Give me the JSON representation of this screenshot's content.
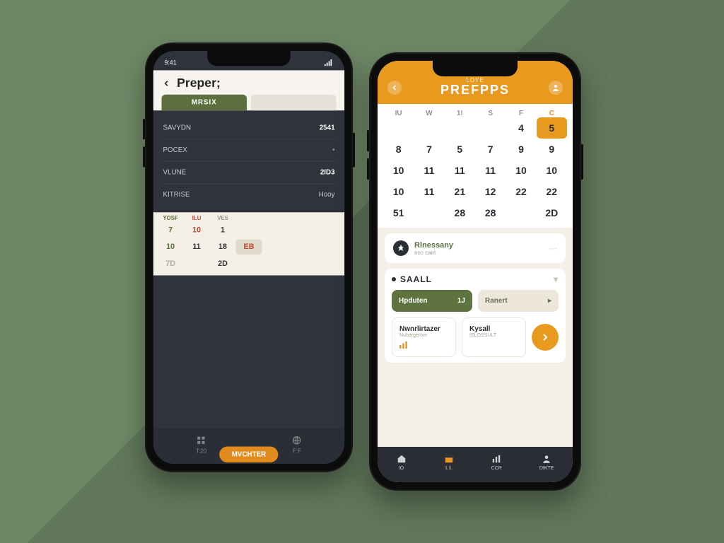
{
  "colors": {
    "accent_orange": "#e89a1f",
    "accent_green": "#5d6f3e",
    "bg_sage": "#6e8866",
    "dark": "#2a2d33"
  },
  "phoneA": {
    "status": {
      "time": "9:41"
    },
    "header": {
      "back_icon": "chevron-left-icon",
      "title": "Preper;",
      "tabs": [
        {
          "label": "MRSIX",
          "active": true
        },
        {
          "label": "",
          "active": false
        }
      ]
    },
    "rows": [
      {
        "label": "SAVYDN",
        "value": "2541"
      },
      {
        "label": "POCEX",
        "value": ""
      },
      {
        "label": "VLUNE",
        "value": "2ID3"
      },
      {
        "label_left": "KITRISE",
        "label_right": "Hooy",
        "split": true
      }
    ],
    "calendar": {
      "header": [
        "YOSF",
        "ILU",
        "VES",
        "",
        "",
        "",
        ""
      ],
      "rows": [
        [
          "7",
          "10",
          "1",
          "",
          "",
          "",
          ""
        ],
        [
          "10",
          "11",
          "18",
          "EB",
          "",
          "",
          ""
        ],
        [
          "7D",
          "",
          "2D",
          "",
          "",
          "",
          ""
        ]
      ]
    },
    "bottom": {
      "items": [
        {
          "icon": "grid-icon",
          "label": "T:20"
        },
        {
          "icon": "globe-icon",
          "label": "F:F"
        }
      ],
      "cta": "MVCHTER"
    }
  },
  "phoneB": {
    "header": {
      "left_icon": "back-icon",
      "subtitle": "LOYE",
      "title": "PREFPPS",
      "right_icon": "profile-icon"
    },
    "calendar": {
      "dow": [
        "IU",
        "W",
        "1!",
        "S",
        "F",
        "C"
      ],
      "dow_active_index": 5,
      "weeks": [
        [
          "",
          "",
          "",
          "",
          "4",
          "5"
        ],
        [
          "8",
          "7",
          "5",
          "7",
          "9",
          "9"
        ],
        [
          "10",
          "11",
          "11",
          "11",
          "10",
          "10"
        ],
        [
          "10",
          "11",
          "21",
          "12",
          "22",
          "22"
        ],
        [
          "51",
          "",
          "28",
          "28",
          "",
          "2D"
        ]
      ],
      "selected": {
        "row": 0,
        "col": 5
      },
      "orange_cells": [
        [
          1,
          0
        ]
      ],
      "green_cells": [
        [
          4,
          0
        ]
      ],
      "faded_cells": [
        [
          0,
          0
        ],
        [
          0,
          1
        ],
        [
          0,
          2
        ],
        [
          0,
          3
        ],
        [
          4,
          1
        ],
        [
          4,
          4
        ]
      ]
    },
    "event": {
      "icon": "pin-icon",
      "label": "Rlnessany",
      "sub": "noɔ caet",
      "trail_icon": "dots-icon"
    },
    "section": {
      "title": "SAALL",
      "toggle_icon": "chevron-down-icon",
      "cards": [
        {
          "style": "green",
          "label": "Hpduten",
          "value": "1J"
        },
        {
          "style": "tan",
          "label": "Ranert",
          "value": ""
        }
      ],
      "cards2": [
        {
          "title": "Nwnrlirtazer",
          "sub": "Nubergeroer",
          "icon": "bars-icon"
        },
        {
          "title": "Kysall",
          "sub": "ISLOSSULT",
          "icon": "stat-icon"
        }
      ],
      "fab_icon": "arrow-right-icon"
    },
    "bottom": {
      "items": [
        {
          "icon": "home-icon",
          "label": "IO"
        },
        {
          "icon": "cal-icon",
          "label": "ILIL",
          "highlight": true
        },
        {
          "icon": "chart-icon",
          "label": "CCR"
        },
        {
          "icon": "user-icon",
          "label": "DIKTE"
        }
      ]
    }
  }
}
